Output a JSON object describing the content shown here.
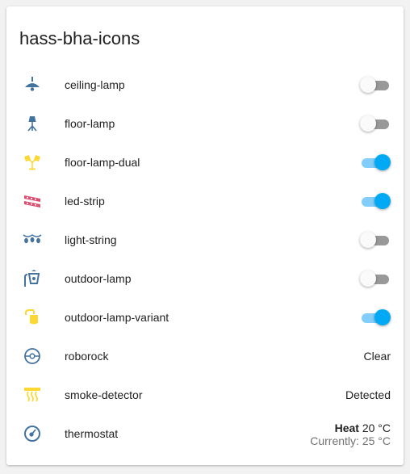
{
  "card": {
    "title": "hass-bha-icons"
  },
  "colors": {
    "icon_off": "#44739e",
    "icon_on": "#fdd835",
    "led_strip": "#db4d6d",
    "toggle_on": "#03a9f4"
  },
  "entities": [
    {
      "icon": "ceiling-lamp-icon",
      "label": "ceiling-lamp",
      "toggle": "off"
    },
    {
      "icon": "floor-lamp-icon",
      "label": "floor-lamp",
      "toggle": "off"
    },
    {
      "icon": "floor-lamp-dual-icon",
      "label": "floor-lamp-dual",
      "toggle": "on"
    },
    {
      "icon": "led-strip-icon",
      "label": "led-strip",
      "toggle": "on"
    },
    {
      "icon": "light-string-icon",
      "label": "light-string",
      "toggle": "off"
    },
    {
      "icon": "outdoor-lamp-icon",
      "label": "outdoor-lamp",
      "toggle": "off"
    },
    {
      "icon": "outdoor-lamp-variant-icon",
      "label": "outdoor-lamp-variant",
      "toggle": "on"
    },
    {
      "icon": "roborock-icon",
      "label": "roborock",
      "state": "Clear"
    },
    {
      "icon": "smoke-detector-icon",
      "label": "smoke-detector",
      "state": "Detected"
    },
    {
      "icon": "thermostat-icon",
      "label": "thermostat",
      "state_mode": "Heat",
      "state_target": "20 °C",
      "state_current": "Currently: 25 °C"
    }
  ]
}
